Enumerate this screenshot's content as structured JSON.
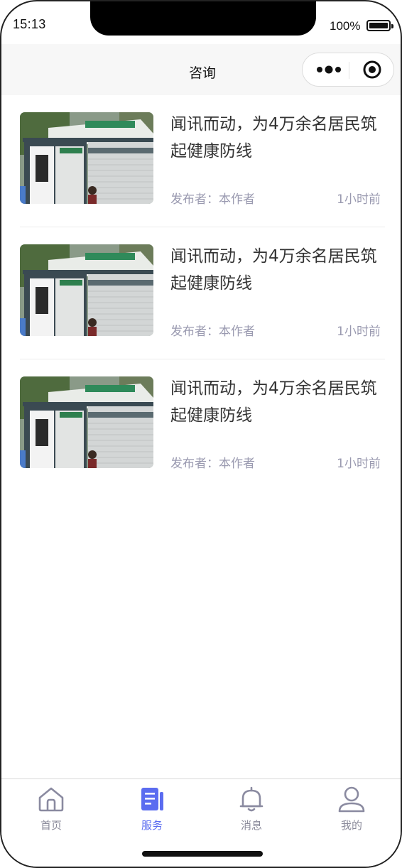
{
  "status_bar": {
    "time": "15:13",
    "battery": "100%"
  },
  "navbar": {
    "title": "咨询"
  },
  "news": [
    {
      "title": "闻讯而动，为4万余名居民筑起健康防线",
      "author": "发布者：本作者",
      "time": "1小时前"
    },
    {
      "title": "闻讯而动，为4万余名居民筑起健康防线",
      "author": "发布者：本作者",
      "time": "1小时前"
    },
    {
      "title": "闻讯而动，为4万余名居民筑起健康防线",
      "author": "发布者：本作者",
      "time": "1小时前"
    }
  ],
  "tabbar": {
    "items": [
      {
        "label": "首页",
        "icon": "home-icon",
        "active": false
      },
      {
        "label": "服务",
        "icon": "document-icon",
        "active": true
      },
      {
        "label": "消息",
        "icon": "bell-icon",
        "active": false
      },
      {
        "label": "我的",
        "icon": "user-icon",
        "active": false
      }
    ]
  },
  "colors": {
    "accent": "#5b6cf0",
    "muted_text": "#9a9ab0",
    "inactive_icon": "#8a8aa0"
  }
}
